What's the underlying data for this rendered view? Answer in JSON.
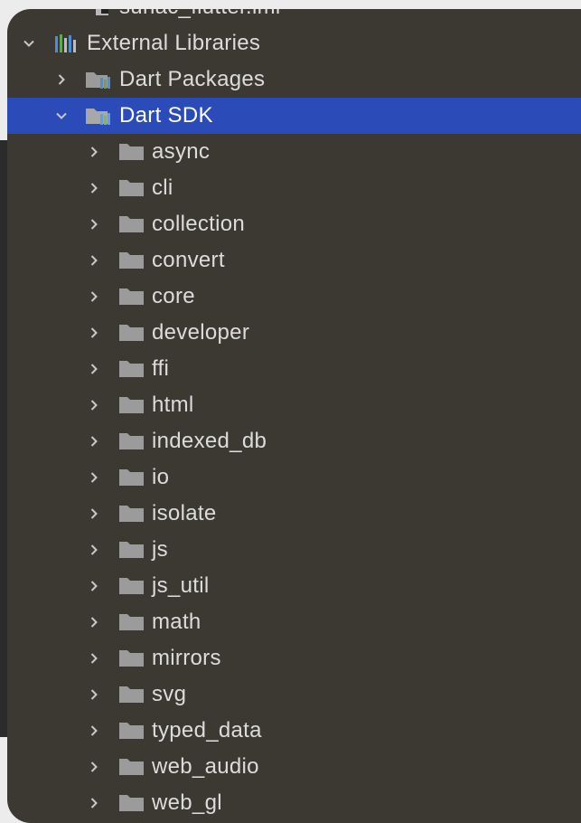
{
  "tree": {
    "cutoff_item": {
      "label": "sunac_flutter.iml",
      "icon": "module-file-icon"
    },
    "external_libraries": {
      "label": "External Libraries",
      "icon": "library-icon",
      "expanded": true
    },
    "dart_packages": {
      "label": "Dart Packages",
      "icon": "library-folder-icon",
      "expanded": false
    },
    "dart_sdk": {
      "label": "Dart SDK",
      "icon": "library-folder-icon",
      "expanded": true,
      "selected": true
    },
    "sdk_folders": [
      {
        "label": "async"
      },
      {
        "label": "cli"
      },
      {
        "label": "collection"
      },
      {
        "label": "convert"
      },
      {
        "label": "core"
      },
      {
        "label": "developer"
      },
      {
        "label": "ffi"
      },
      {
        "label": "html"
      },
      {
        "label": "indexed_db"
      },
      {
        "label": "io"
      },
      {
        "label": "isolate"
      },
      {
        "label": "js"
      },
      {
        "label": "js_util"
      },
      {
        "label": "math"
      },
      {
        "label": "mirrors"
      },
      {
        "label": "svg"
      },
      {
        "label": "typed_data"
      },
      {
        "label": "web_audio"
      },
      {
        "label": "web_gl"
      }
    ]
  },
  "colors": {
    "panel_bg": "#3c3933",
    "selection": "#2a4bb8",
    "text": "#dcdcdc",
    "folder": "#9b9b9b",
    "chevron": "#c8c8c8"
  }
}
